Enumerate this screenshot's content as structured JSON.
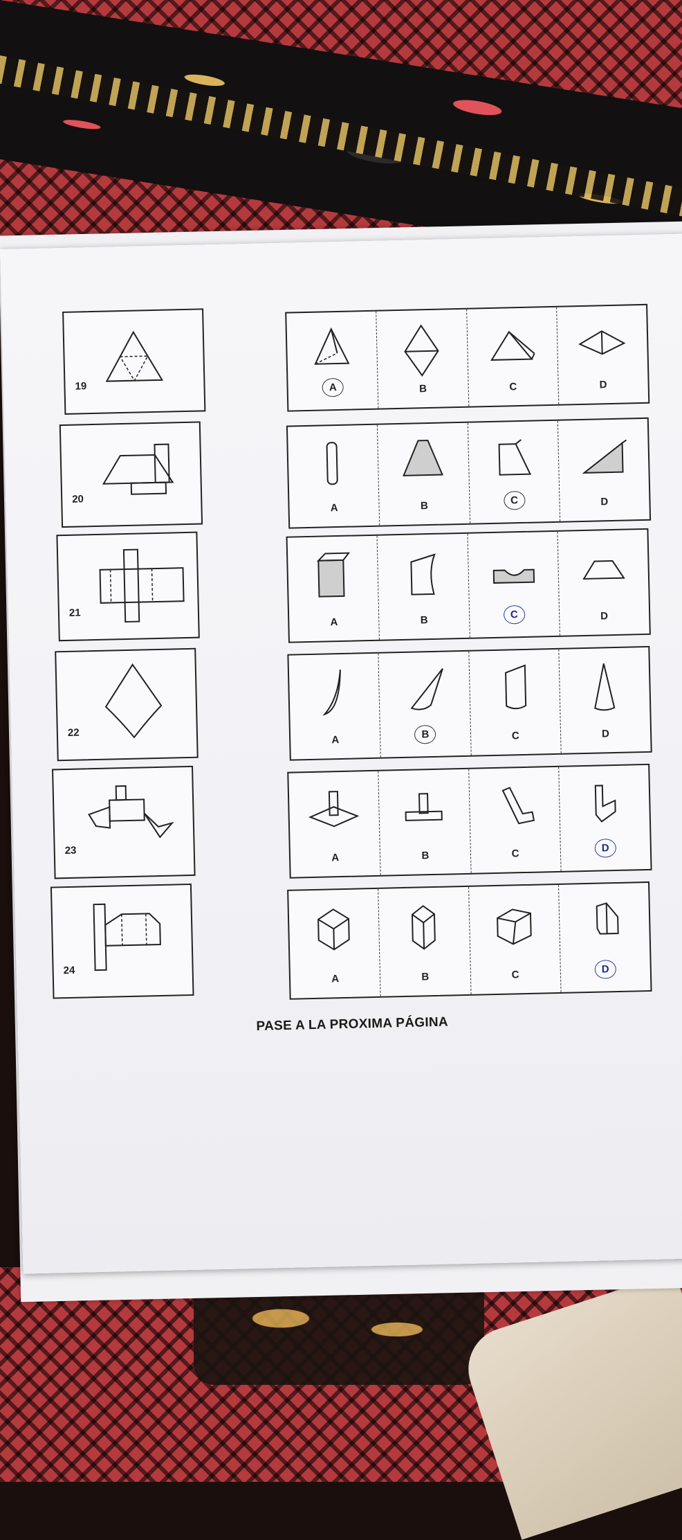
{
  "questions": [
    {
      "number": "19",
      "options": [
        "A",
        "B",
        "C",
        "D"
      ],
      "marked": "A"
    },
    {
      "number": "20",
      "options": [
        "A",
        "B",
        "C",
        "D"
      ],
      "marked": "C"
    },
    {
      "number": "21",
      "options": [
        "A",
        "B",
        "C",
        "D"
      ],
      "marked": "C"
    },
    {
      "number": "22",
      "options": [
        "A",
        "B",
        "C",
        "D"
      ],
      "marked": "B"
    },
    {
      "number": "23",
      "options": [
        "A",
        "B",
        "C",
        "D"
      ],
      "marked": "D"
    },
    {
      "number": "24",
      "options": [
        "A",
        "B",
        "C",
        "D"
      ],
      "marked": "D"
    }
  ],
  "footer_text": "PASE A LA PROXIMA PÁGINA",
  "colors": {
    "carpet_red": "#b53a3e",
    "carpet_gold": "#d4b35d",
    "pen_blue": "#2a3b9e"
  }
}
